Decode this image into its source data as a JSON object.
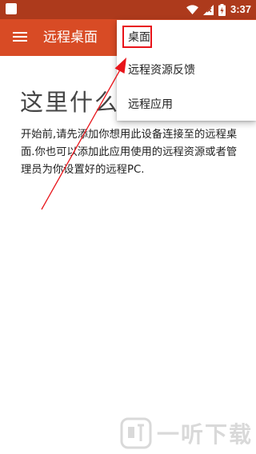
{
  "status_bar": {
    "time": "3:37"
  },
  "app_bar": {
    "title": "远程桌面"
  },
  "main": {
    "heading": "这里什么",
    "description": "开始前,请先添加你想用此设备连接至的远程桌面.你也可以添加此应用使用的远程资源或者管理员为你设置好的远程PC."
  },
  "menu": {
    "items": [
      {
        "label": "桌面"
      },
      {
        "label": "远程资源反馈"
      },
      {
        "label": "远程应用"
      }
    ]
  },
  "watermark": {
    "text": "一听下载"
  },
  "colors": {
    "status_bar": "#ad3a1c",
    "app_bar": "#d84b25",
    "annotation": "#e8141a"
  }
}
